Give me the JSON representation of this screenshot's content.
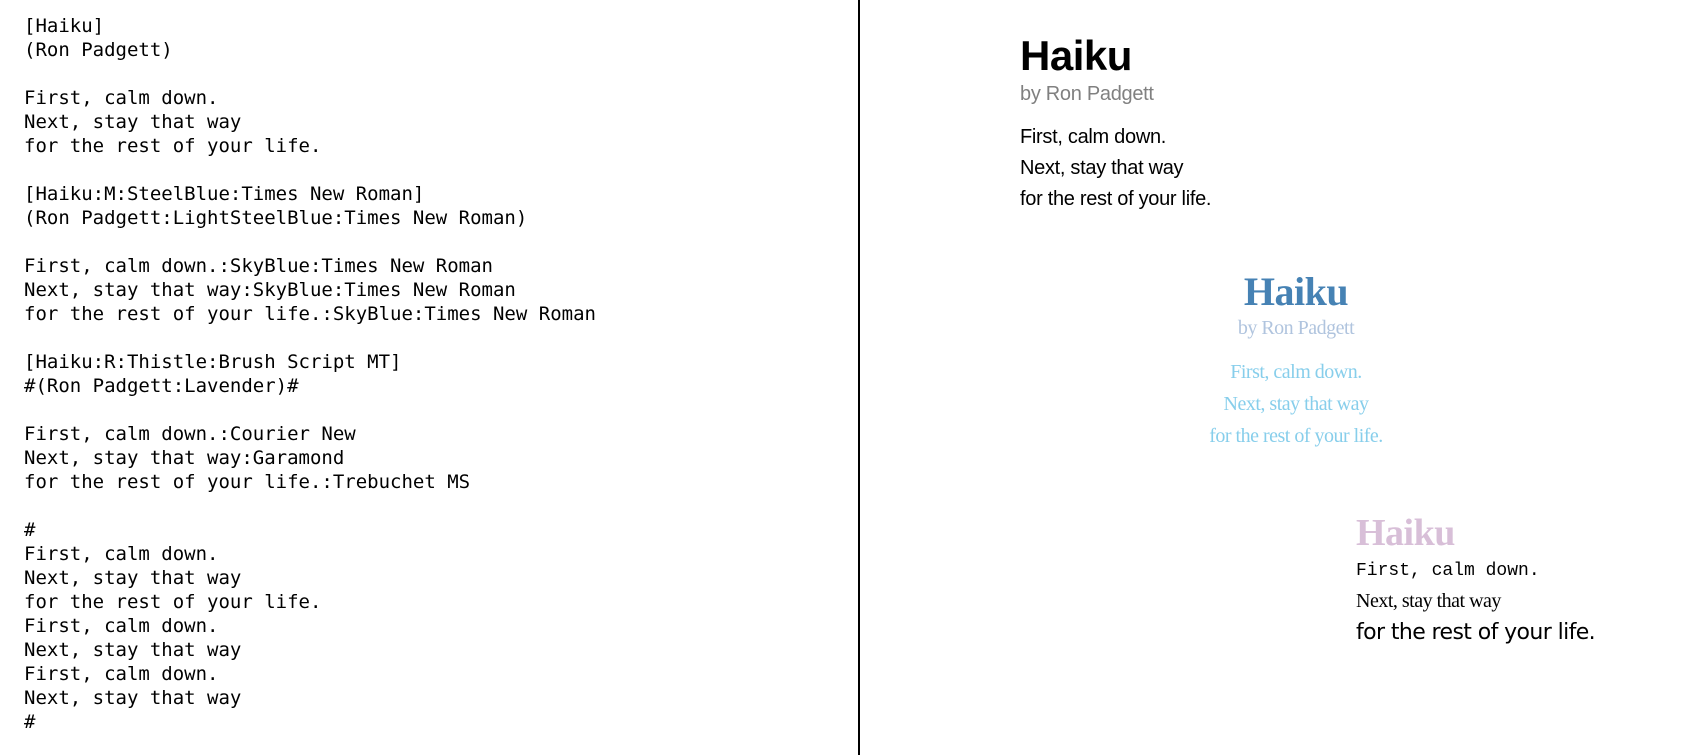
{
  "source": {
    "lines": [
      "[Haiku]",
      "(Ron Padgett)",
      "",
      "First, calm down.",
      "Next, stay that way",
      "for the rest of your life.",
      "",
      "[Haiku:M:SteelBlue:Times New Roman]",
      "(Ron Padgett:LightSteelBlue:Times New Roman)",
      "",
      "First, calm down.:SkyBlue:Times New Roman",
      "Next, stay that way:SkyBlue:Times New Roman",
      "for the rest of your life.:SkyBlue:Times New Roman",
      "",
      "[Haiku:R:Thistle:Brush Script MT]",
      "#(Ron Padgett:Lavender)#",
      "",
      "First, calm down.:Courier New",
      "Next, stay that way:Garamond",
      "for the rest of your life.:Trebuchet MS",
      "",
      "#",
      "First, calm down.",
      "Next, stay that way",
      "for the rest of your life.",
      "First, calm down.",
      "Next, stay that way",
      "First, calm down.",
      "Next, stay that way",
      "#"
    ]
  },
  "preview": {
    "poem1": {
      "title": "Haiku",
      "author": "by Ron Padgett",
      "lines": [
        "First, calm down.",
        "Next, stay that way",
        "for the rest of your life."
      ],
      "colors": {
        "title": "#000000",
        "author": "#808080",
        "lines": "#000000"
      }
    },
    "poem2": {
      "title": "Haiku",
      "author": "by Ron Padgett",
      "lines": [
        "First, calm down.",
        "Next, stay that way",
        "for the rest of your life."
      ],
      "colors": {
        "title": "#4682B4",
        "author": "#B0C4DE",
        "lines": "#87CEEB"
      }
    },
    "poem3": {
      "title": "Haiku",
      "lines": [
        "First, calm down.",
        "Next, stay that way",
        "for the rest of your life."
      ],
      "colors": {
        "title": "#D8BFD8",
        "lines": "#000000"
      }
    }
  }
}
